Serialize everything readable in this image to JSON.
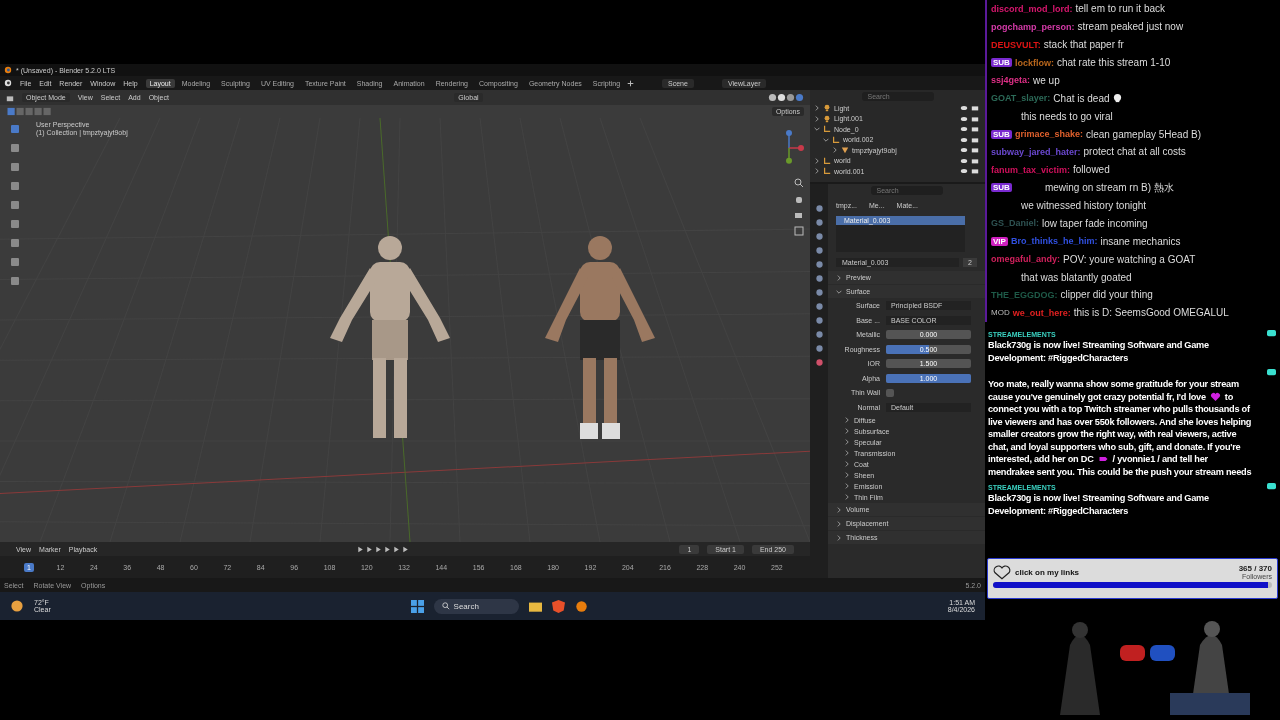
{
  "blender": {
    "title": "* (Unsaved) - Blender 5.2.0 LTS",
    "menus": [
      "File",
      "Edit",
      "Render",
      "Window",
      "Help"
    ],
    "workspaces": [
      {
        "label": "Layout",
        "selected": true
      },
      {
        "label": "Modeling",
        "selected": false
      },
      {
        "label": "Sculpting",
        "selected": false
      },
      {
        "label": "UV Editing",
        "selected": false
      },
      {
        "label": "Texture Paint",
        "selected": false
      },
      {
        "label": "Shading",
        "selected": false
      },
      {
        "label": "Animation",
        "selected": false
      },
      {
        "label": "Rendering",
        "selected": false
      },
      {
        "label": "Compositing",
        "selected": false
      },
      {
        "label": "Geometry Nodes",
        "selected": false
      },
      {
        "label": "Scripting",
        "selected": false
      }
    ],
    "scene": "Scene",
    "view_layer": "ViewLayer",
    "viewport_header": {
      "mode": "Object Mode",
      "menus": [
        "View",
        "Select",
        "Add",
        "Object"
      ],
      "orientation": "Global",
      "options": "Options"
    },
    "viewport": {
      "perspective": "User Perspective",
      "collection": "(1) Collection | tmpztyajyt9obj"
    },
    "outliner": {
      "search_placeholder": "Search",
      "items": [
        {
          "label": "Light",
          "kind": "light",
          "expanded": false
        },
        {
          "label": "Light.001",
          "kind": "light",
          "expanded": false
        },
        {
          "label": "Node_0",
          "kind": "empty",
          "expanded": true,
          "children": [
            {
              "label": "world.002",
              "kind": "empty",
              "expanded": true,
              "children": [
                {
                  "label": "tmpztyajyt9obj",
                  "kind": "mesh",
                  "expanded": false
                }
              ]
            }
          ]
        },
        {
          "label": "world",
          "kind": "empty",
          "expanded": false
        },
        {
          "label": "world.001",
          "kind": "empty",
          "expanded": false
        }
      ]
    },
    "properties": {
      "search_placeholder": "Search",
      "breadcrumb": [
        "tmpz...",
        "Me...",
        "Mate..."
      ],
      "slots": [
        {
          "label": "Material_0.003",
          "selected": true
        }
      ],
      "material_name": "Material_0.003",
      "users": "2",
      "panels": [
        {
          "label": "Preview",
          "expanded": false
        },
        {
          "label": "Surface",
          "expanded": true
        }
      ],
      "surface_label": "Surface",
      "surface": "Principled BSDF",
      "fields": [
        {
          "kind": "link",
          "label": "Base ...",
          "value": "BASE COLOR"
        },
        {
          "kind": "number",
          "label": "Metallic",
          "value": "0.000"
        },
        {
          "kind": "number",
          "label": "Roughness",
          "value": "0.500",
          "level": 0.5
        },
        {
          "kind": "number",
          "label": "IOR",
          "value": "1.500"
        },
        {
          "kind": "number",
          "label": "Alpha",
          "value": "1.000",
          "level": 1
        },
        {
          "kind": "checkbox",
          "label": "Thin Wall",
          "checked": false
        },
        {
          "kind": "link",
          "label": "Normal",
          "value": "Default"
        }
      ],
      "subpanels": [
        "Diffuse",
        "Subsurface",
        "Specular",
        "Transmission",
        "Coat",
        "Sheen",
        "Emission",
        "Thin Film"
      ],
      "more_panels": [
        "Volume",
        "Displacement",
        "Thickness"
      ]
    },
    "timeline": {
      "menus": [
        "View",
        "Marker",
        "Playback"
      ],
      "current_frame": "1",
      "start_label": "Start",
      "start": "1",
      "end_label": "End",
      "end": "250",
      "ticks": [
        {
          "label": "1",
          "selected": true
        },
        {
          "label": "12",
          "selected": false
        },
        {
          "label": "24",
          "selected": false
        },
        {
          "label": "36",
          "selected": false
        },
        {
          "label": "48",
          "selected": false
        },
        {
          "label": "60",
          "selected": false
        },
        {
          "label": "72",
          "selected": false
        },
        {
          "label": "84",
          "selected": false
        },
        {
          "label": "96",
          "selected": false
        },
        {
          "label": "108",
          "selected": false
        },
        {
          "label": "120",
          "selected": false
        },
        {
          "label": "132",
          "selected": false
        },
        {
          "label": "144",
          "selected": false
        },
        {
          "label": "156",
          "selected": false
        },
        {
          "label": "168",
          "selected": false
        },
        {
          "label": "180",
          "selected": false
        },
        {
          "label": "192",
          "selected": false
        },
        {
          "label": "204",
          "selected": false
        },
        {
          "label": "216",
          "selected": false
        },
        {
          "label": "228",
          "selected": false
        },
        {
          "label": "240",
          "selected": false
        },
        {
          "label": "252",
          "selected": false
        }
      ]
    },
    "status_bar": {
      "hints": [
        "Select",
        "Rotate View",
        "Options"
      ],
      "version": "5.2.0"
    }
  },
  "taskbar": {
    "temperature": "72°F",
    "weather": "Clear",
    "search": "Search",
    "time": "1:51 AM",
    "date": "8/4/2026"
  },
  "chat": [
    {
      "user": "discord_mod_lord:",
      "color": "#d8166e",
      "text": "tell em to run it back"
    },
    {
      "user": "pogchamp_person:",
      "color": "#d43aa8",
      "text": "stream peaked just now"
    },
    {
      "user": "DEUSVULT:",
      "color": "#e01414",
      "text": "stack that paper fr"
    },
    {
      "badge": "SUB",
      "user": "lockflow:",
      "color": "#b8661c",
      "text": "chat rate this stream 1-10"
    },
    {
      "user": "ssj4geta:",
      "color": "#de2f86",
      "text": "we up"
    },
    {
      "user": "GOAT_slayer:",
      "color": "#2c6a58",
      "text": "Chat is dead",
      "skull": true
    },
    {
      "text": "this needs to go viral"
    },
    {
      "badge": "SUB",
      "user": "grimace_shake:",
      "color": "#e0602c",
      "text": "clean gameplay 5Head B)"
    },
    {
      "user": "subway_jared_hater:",
      "color": "#6a48d0",
      "text": "protect chat at all costs"
    },
    {
      "user": "fanum_tax_victim:",
      "color": "#d0105c",
      "text": "followed"
    },
    {
      "badge": "SUB",
      "text": "mewing on stream rn B) 熱水"
    },
    {
      "text": "we witnessed history tonight"
    },
    {
      "user": "GS_Daniel:",
      "color": "#2e5252",
      "text": "low taper fade incoming"
    },
    {
      "badge": "VIP",
      "user": "Bro_thinks_he_him:",
      "color": "#3050e0",
      "text": "insane mechanics"
    },
    {
      "user": "omegaful_andy:",
      "color": "#d0205c",
      "text": "POV: youre watching a GOAT"
    },
    {
      "text": "that was blatantly goated"
    },
    {
      "user": "THE_EGGDOG:",
      "color": "#1e5a48",
      "text": "clipper did your thing"
    },
    {
      "badge": "MOD",
      "user": "we_out_here:",
      "color": "#e02020",
      "text": "this is D: SeemsGood OMEGALUL"
    }
  ],
  "alerts": [
    {
      "source": "STREAMELEMENTS",
      "lines": [
        {
          "parts": [
            "Black730g is now live! Streaming Software and Game"
          ]
        },
        {
          "parts": [
            "Development: #RiggedCharacters"
          ]
        }
      ]
    },
    {
      "lines": [
        {
          "parts": [
            "Yoo mate, really wanna show some gratitude for your stream"
          ]
        },
        {
          "parts": [
            "cause you've genuinely got crazy potential fr, I'd love",
            "to"
          ],
          "kind": "heart"
        },
        {
          "parts": [
            "connect you with a top Twitch streamer who pulls thousands of"
          ]
        },
        {
          "parts": [
            "live viewers and has over 550k followers. And she loves helping"
          ]
        },
        {
          "parts": [
            "smaller creators grow the right way, with real viewers, active"
          ]
        },
        {
          "parts": [
            "chat, and loyal supporters who sub, gift, and donate. If you're"
          ]
        },
        {
          "parts": [
            "interested, add her on DC",
            "/ yvonnie1 / and tell her"
          ],
          "kind": "hand"
        },
        {
          "parts": [
            "mendrakee sent you. This could be the push your stream needs"
          ]
        }
      ]
    },
    {
      "source": "STREAMELEMENTS",
      "lines": [
        {
          "parts": [
            "Black730g is now live! Streaming Software and Game"
          ]
        },
        {
          "parts": [
            "Development: #RiggedCharacters"
          ]
        }
      ]
    }
  ],
  "follower_goal": {
    "label": "click on my links",
    "count": "365 / 370",
    "unit": "Followers",
    "level": 0.986
  }
}
